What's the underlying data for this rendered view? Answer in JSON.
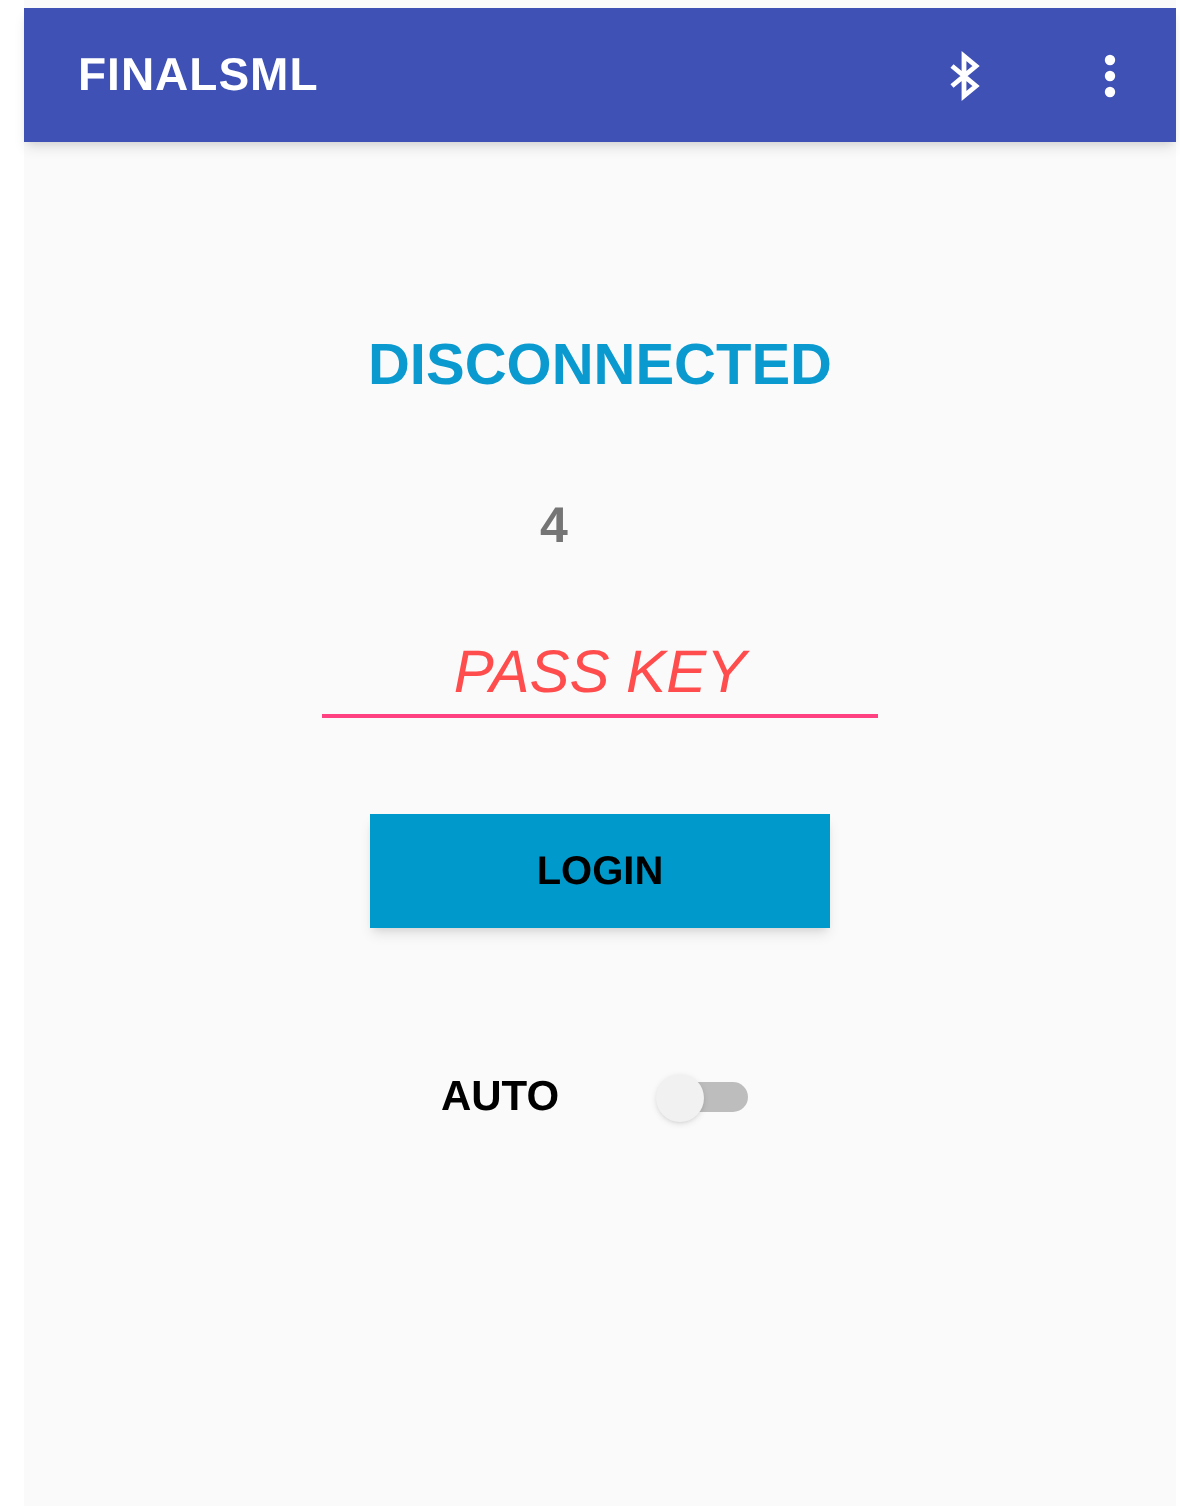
{
  "app_bar": {
    "title": "FINALSML"
  },
  "status": "DISCONNECTED",
  "count": "4",
  "pass_key": {
    "placeholder": "PASS KEY"
  },
  "login_button": "LOGIN",
  "auto": {
    "label": "AUTO",
    "on": false
  }
}
